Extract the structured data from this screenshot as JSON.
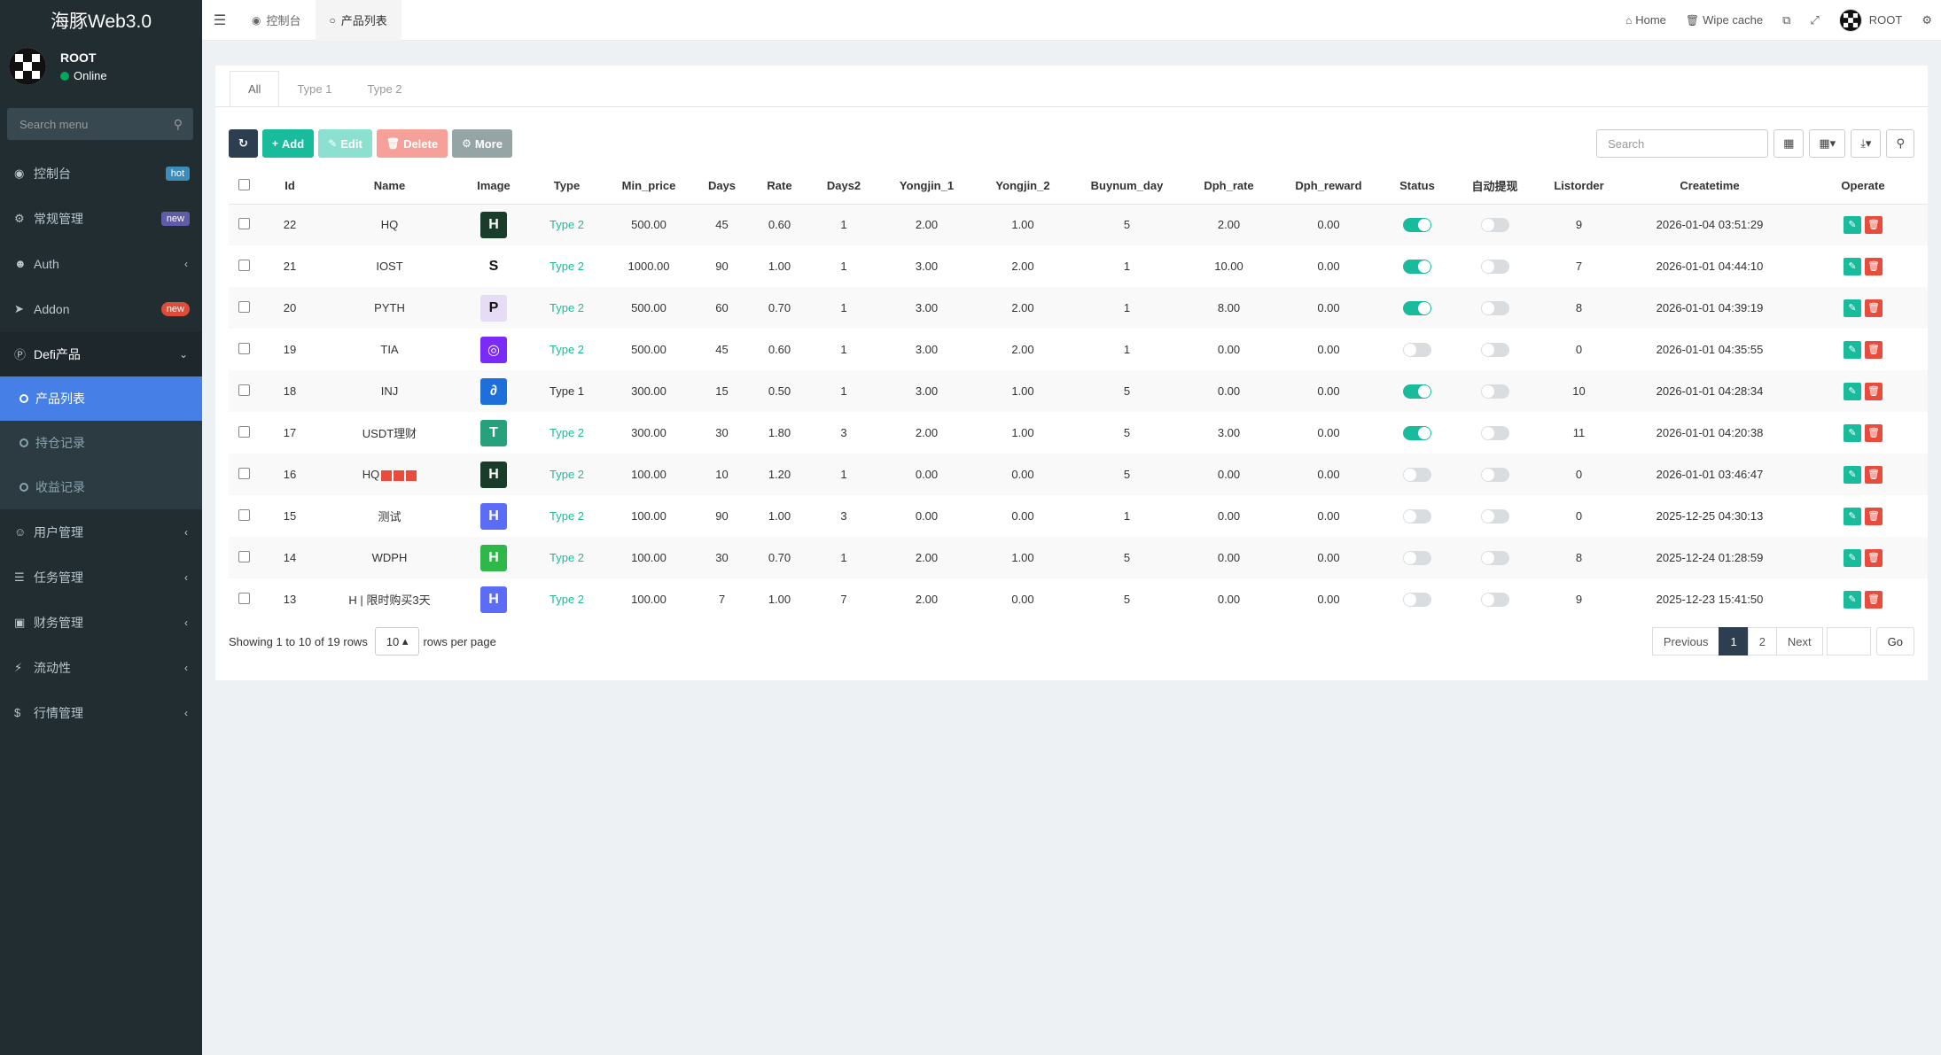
{
  "app": {
    "logo_text": "海豚Web3.0",
    "user_name": "ROOT",
    "user_status": "Online",
    "search_placeholder": "Search menu"
  },
  "sidebar": {
    "items": [
      {
        "label": "控制台",
        "icon": "dashboard-icon",
        "badge": "hot"
      },
      {
        "label": "常规管理",
        "icon": "cogs-icon",
        "badge": "new"
      },
      {
        "label": "Auth",
        "icon": "group-icon",
        "caret": "‹"
      },
      {
        "label": "Addon",
        "icon": "rocket-icon",
        "badge": "new"
      },
      {
        "label": "Defi产品",
        "icon": "product-icon",
        "caret": "⌄"
      }
    ],
    "submenu": [
      {
        "label": "产品列表",
        "active": true
      },
      {
        "label": "持仓记录",
        "active": false
      },
      {
        "label": "收益记录",
        "active": false
      }
    ],
    "items_after": [
      {
        "label": "用户管理",
        "icon": "user-circle-icon",
        "caret": "‹"
      },
      {
        "label": "任务管理",
        "icon": "list-icon",
        "caret": "‹"
      },
      {
        "label": "财务管理",
        "icon": "money-icon",
        "caret": "‹"
      },
      {
        "label": "流动性",
        "icon": "bolt-icon",
        "caret": "‹"
      },
      {
        "label": "行情管理",
        "icon": "dollar-icon",
        "caret": "‹"
      }
    ]
  },
  "header": {
    "tabs": [
      {
        "label": "控制台",
        "icon": "dashboard-icon"
      },
      {
        "label": "产品列表",
        "icon": "circle-icon"
      }
    ],
    "home": "Home",
    "wipe_cache": "Wipe cache",
    "user": "ROOT"
  },
  "subtabs": [
    "All",
    "Type 1",
    "Type 2"
  ],
  "toolbar": {
    "add": "Add",
    "edit": "Edit",
    "delete": "Delete",
    "more": "More",
    "search_placeholder": "Search"
  },
  "table": {
    "columns": [
      "Id",
      "Name",
      "Image",
      "Type",
      "Min_price",
      "Days",
      "Rate",
      "Days2",
      "Yongjin_1",
      "Yongjin_2",
      "Buynum_day",
      "Dph_rate",
      "Dph_reward",
      "Status",
      "自动提现",
      "Listorder",
      "Createtime",
      "Operate"
    ],
    "rows": [
      {
        "id": "22",
        "name": "HQ",
        "img": "H",
        "img_color": "#1a3d2b",
        "type": "Type 2",
        "min_price": "500.00",
        "days": "45",
        "rate": "0.60",
        "days2": "1",
        "y1": "2.00",
        "y2": "1.00",
        "buynum": "5",
        "dph_rate": "2.00",
        "dph_reward": "0.00",
        "status": true,
        "auto": false,
        "listorder": "9",
        "createtime": "2026-01-04 03:51:29"
      },
      {
        "id": "21",
        "name": "IOST",
        "img": "S",
        "img_color": "#ffffff",
        "type": "Type 2",
        "min_price": "1000.00",
        "days": "90",
        "rate": "1.00",
        "days2": "1",
        "y1": "3.00",
        "y2": "2.00",
        "buynum": "1",
        "dph_rate": "10.00",
        "dph_reward": "0.00",
        "status": true,
        "auto": false,
        "listorder": "7",
        "createtime": "2026-01-01 04:44:10"
      },
      {
        "id": "20",
        "name": "PYTH",
        "img": "P",
        "img_color": "#e6dcf5",
        "type": "Type 2",
        "min_price": "500.00",
        "days": "60",
        "rate": "0.70",
        "days2": "1",
        "y1": "3.00",
        "y2": "2.00",
        "buynum": "1",
        "dph_rate": "8.00",
        "dph_reward": "0.00",
        "status": true,
        "auto": false,
        "listorder": "8",
        "createtime": "2026-01-01 04:39:19"
      },
      {
        "id": "19",
        "name": "TIA",
        "img": "◎",
        "img_color": "#7b2bf9",
        "type": "Type 2",
        "min_price": "500.00",
        "days": "45",
        "rate": "0.60",
        "days2": "1",
        "y1": "3.00",
        "y2": "2.00",
        "buynum": "1",
        "dph_rate": "0.00",
        "dph_reward": "0.00",
        "status": false,
        "auto": false,
        "listorder": "0",
        "createtime": "2026-01-01 04:35:55"
      },
      {
        "id": "18",
        "name": "INJ",
        "img": "∂",
        "img_color": "#1e6fd9",
        "type": "Type 1",
        "min_price": "300.00",
        "days": "15",
        "rate": "0.50",
        "days2": "1",
        "y1": "3.00",
        "y2": "1.00",
        "buynum": "5",
        "dph_rate": "0.00",
        "dph_reward": "0.00",
        "status": true,
        "auto": false,
        "listorder": "10",
        "createtime": "2026-01-01 04:28:34"
      },
      {
        "id": "17",
        "name": "USDT理财",
        "img": "T",
        "img_color": "#26a17b",
        "type": "Type 2",
        "min_price": "300.00",
        "days": "30",
        "rate": "1.80",
        "days2": "3",
        "y1": "2.00",
        "y2": "1.00",
        "buynum": "5",
        "dph_rate": "3.00",
        "dph_reward": "0.00",
        "status": true,
        "auto": false,
        "listorder": "11",
        "createtime": "2026-01-01 04:20:38"
      },
      {
        "id": "16",
        "name": "HQ",
        "img": "H",
        "img_color": "#1a3d2b",
        "type": "Type 2",
        "min_price": "100.00",
        "days": "10",
        "rate": "1.20",
        "days2": "1",
        "y1": "0.00",
        "y2": "0.00",
        "buynum": "5",
        "dph_rate": "0.00",
        "dph_reward": "0.00",
        "status": false,
        "auto": false,
        "listorder": "0",
        "createtime": "2026-01-01 03:46:47"
      },
      {
        "id": "15",
        "name": "测试",
        "img": "H",
        "img_color": "#5b6cf6",
        "type": "Type 2",
        "min_price": "100.00",
        "days": "90",
        "rate": "1.00",
        "days2": "3",
        "y1": "0.00",
        "y2": "0.00",
        "buynum": "1",
        "dph_rate": "0.00",
        "dph_reward": "0.00",
        "status": false,
        "auto": false,
        "listorder": "0",
        "createtime": "2025-12-25 04:30:13"
      },
      {
        "id": "14",
        "name": "WDPH",
        "img": "H",
        "img_color": "#2fb84a",
        "type": "Type 2",
        "min_price": "100.00",
        "days": "30",
        "rate": "0.70",
        "days2": "1",
        "y1": "2.00",
        "y2": "1.00",
        "buynum": "5",
        "dph_rate": "0.00",
        "dph_reward": "0.00",
        "status": false,
        "auto": false,
        "listorder": "8",
        "createtime": "2025-12-24 01:28:59"
      },
      {
        "id": "13",
        "name": "H | 限时购买3天",
        "img": "H",
        "img_color": "#5b6cf6",
        "type": "Type 2",
        "min_price": "100.00",
        "days": "7",
        "rate": "1.00",
        "days2": "7",
        "y1": "2.00",
        "y2": "0.00",
        "buynum": "5",
        "dph_rate": "0.00",
        "dph_reward": "0.00",
        "status": false,
        "auto": false,
        "listorder": "9",
        "createtime": "2025-12-23 15:41:50"
      }
    ]
  },
  "footer": {
    "showing": "Showing 1 to 10 of 19 rows",
    "page_size": "10",
    "rows_per_page": "rows per page",
    "previous": "Previous",
    "pages": [
      "1",
      "2"
    ],
    "current_page": "1",
    "next": "Next",
    "go": "Go"
  }
}
